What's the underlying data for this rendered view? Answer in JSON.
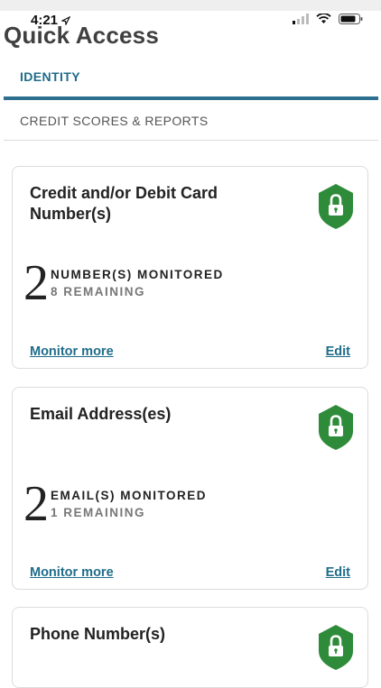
{
  "status_bar": {
    "time": "4:21",
    "icons": [
      "location-arrow-icon",
      "signal-icon",
      "wifi-icon",
      "battery-icon"
    ]
  },
  "header": {
    "title": "Quick Access"
  },
  "tabs": [
    {
      "label": "IDENTITY",
      "active": true
    },
    {
      "label": "CREDIT SCORES & REPORTS",
      "active": false
    }
  ],
  "cards": [
    {
      "title": "Credit and/or Debit Card Number(s)",
      "icon": "lock-shield-icon",
      "count": "2",
      "monitored_label": "NUMBER(S) MONITORED",
      "remaining_label": "8 REMAINING",
      "monitor_more": "Monitor more",
      "edit": "Edit"
    },
    {
      "title": "Email Address(es)",
      "icon": "lock-shield-icon",
      "count": "2",
      "monitored_label": "EMAIL(S) MONITORED",
      "remaining_label": "1 REMAINING",
      "monitor_more": "Monitor more",
      "edit": "Edit"
    },
    {
      "title": "Phone Number(s)",
      "icon": "lock-shield-icon"
    }
  ],
  "colors": {
    "accent": "#1f6c8a",
    "shield_green": "#2e8b3a",
    "tab_underline": "#2c6f8e"
  }
}
